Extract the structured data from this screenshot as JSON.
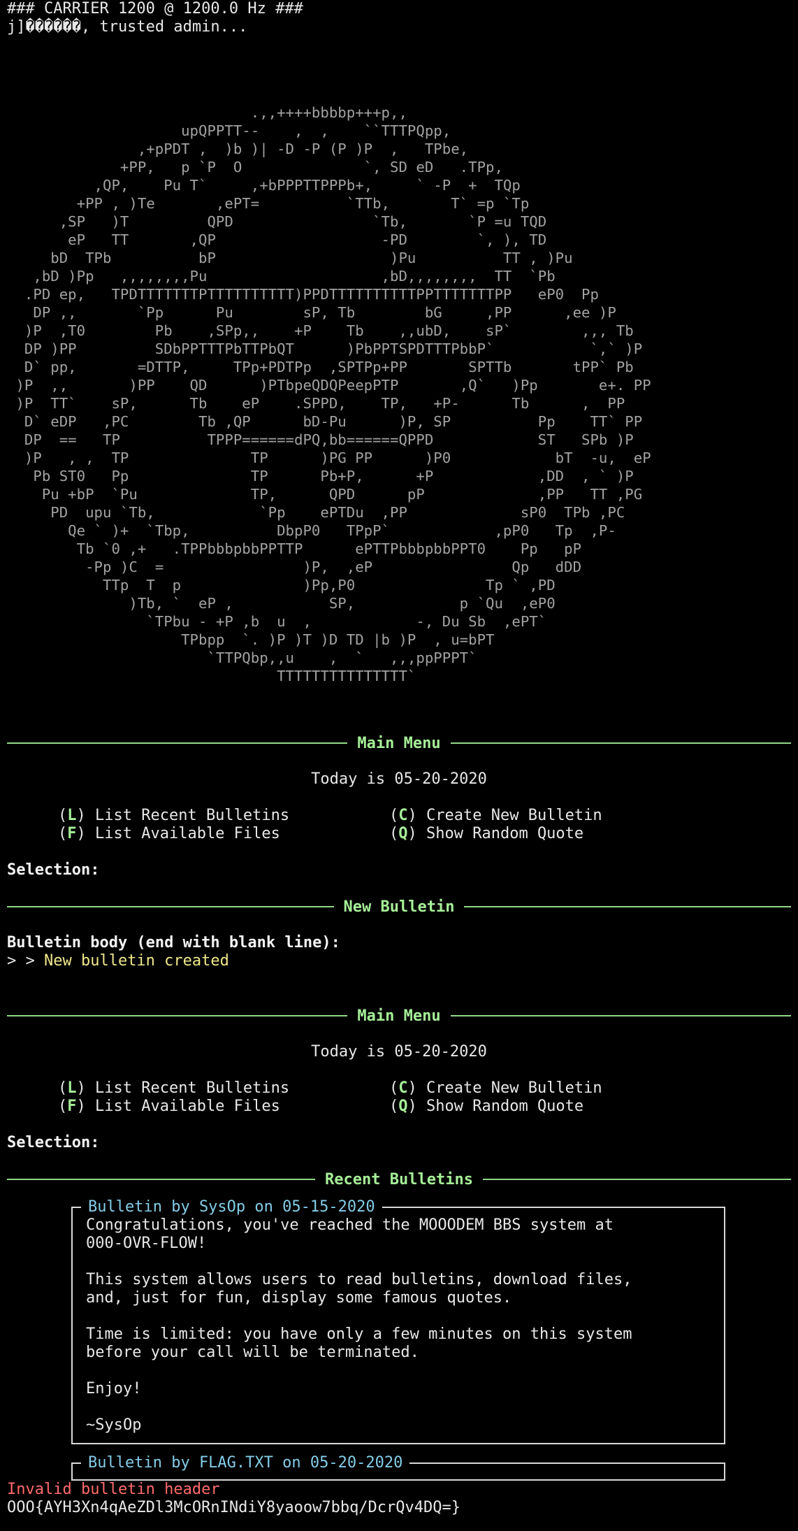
{
  "header": {
    "carrier": "### CARRIER 1200 @ 1200.0 Hz ###",
    "login": "j]������, trusted admin..."
  },
  "ascii_art": [
    "                            .,,++++bbbbp+++p,,",
    "                    upQPPTT--    ,  ,    ``TTTPQpp,",
    "               ,+pPDT ,  )b )| -D -P (P )P  ,   TPbe,",
    "             +PP,   p `P  O              `, SD eD   .TPp,",
    "          ,QP,    Pu T`     ,+bPPPTTPPPb+,     ` -P  +  TQp",
    "        +PP , )Te       ,ePT=          `TTb,       T` =p `Tp",
    "      ,SP   )T         QPD                `Tb,       `P =u TQD",
    "       eP   TT       ,QP                   -PD        `, ), TD",
    "     bD  TPb          bP                    )Pu          TT , )Pu",
    "   ,bD )Pp   ,,,,,,,,Pu                    ,bD,,,,,,,,  TT  `Pb",
    "  .PD ep,   TPDTTTTTTTPTTTTTTTTTT)PPDTTTTTTTTTTPPTTTTTTTPP   eP0  Pp",
    "   DP ,,       `Pp      Pu        sP, Tb        bG     ,PP      ,ee )P",
    "  )P  ,T0        Pb    ,SPp,,    +P    Tb    ,,ubD,    sP`        ,,, Tb",
    "  DP )PP         SDbPPTTTPbTTPbQT      )PbPPTSPDTTTPbbP`           `,` )P",
    "  D` pp,       =DTTP,     TPp+PDTPp  ,SPTPp+PP       SPTTb       tPP` Pb",
    " )P  ,,       )PP    QD      )PTbpeQDQPeepPTP       ,Q`   )Pp       e+. PP",
    " )P  TT`    sP,      Tb    eP    .SPPD,    TP,   +P-      Tb      ,  PP",
    "  D` eDP   ,PC        Tb ,QP      bD-Pu      )P, SP          Pp    TT` PP",
    "  DP  ==   TP          TPPP======dPQ,bb======QPPD            ST   SPb )P",
    "  )P   , ,  TP              TP      )PG PP      )P0            bT  -u,  eP",
    "   Pb ST0   Pp              TP      Pb+P,      +P            ,DD  , ` )P",
    "    Pu +bP  `Pu             TP,      QPD      pP             ,PP   TT ,PG",
    "     PD  upu `Tb,            `Pp    ePTDu  ,PP             sP0  TPb ,PC",
    "       Qe ` )+  `Tbp,          DbpP0   TPpP`            ,pP0   Tp  ,P-",
    "        Tb `0 ,+   .TPPbbbpbbPPTTP      ePTTPbbbpbbPPT0    Pp   pP",
    "         -Pp )C  =                )P,  ,eP                Qp   dDD",
    "           TTp  T  p              )Pp,P0               Tp ` ,PD",
    "              )Tb, `  eP ,           SP,            p `Qu  ,eP0",
    "                `TPbu - +P ,b  u  ,            -, Du Sb  ,ePT`",
    "                    TPbpp  `. )P )T )D TD |b )P  , u=bPT",
    "                       `TTPQbp,,u    ,  `   ,,,ppPPPT`",
    "                               TTTTTTTTTTTTTTT`"
  ],
  "menu1": {
    "title": "Main Menu",
    "date": "Today is 05-20-2020",
    "items": [
      {
        "key": "L",
        "label": "List Recent Bulletins"
      },
      {
        "key": "C",
        "label": "Create New Bulletin"
      },
      {
        "key": "F",
        "label": "List Available Files"
      },
      {
        "key": "Q",
        "label": "Show Random Quote"
      }
    ],
    "prompt": "Selection:"
  },
  "new_bulletin": {
    "title": "New Bulletin",
    "prompt": "Bulletin body (end with blank line):",
    "input_marks": "> > ",
    "result": "New bulletin created"
  },
  "menu2": {
    "title": "Main Menu",
    "date": "Today is 05-20-2020",
    "items": [
      {
        "key": "L",
        "label": "List Recent Bulletins"
      },
      {
        "key": "C",
        "label": "Create New Bulletin"
      },
      {
        "key": "F",
        "label": "List Available Files"
      },
      {
        "key": "Q",
        "label": "Show Random Quote"
      }
    ],
    "prompt": "Selection:"
  },
  "recent": {
    "title": "Recent Bulletins",
    "bulletins": [
      {
        "header": "Bulletin by SysOp on 05-15-2020",
        "lines": [
          "Congratulations, you've reached the MOOODEM BBS system at",
          "000-OVR-FLOW!",
          "",
          "This system allows users to read bulletins, download files,",
          "and, just for fun, display some famous quotes.",
          "",
          "Time is limited: you have only a few minutes on this system",
          "before your call will be terminated.",
          "",
          "Enjoy!",
          "",
          "~SysOp"
        ]
      },
      {
        "header": "Bulletin by FLAG.TXT on 05-20-2020",
        "lines": []
      }
    ],
    "error": "Invalid bulletin header",
    "flag": "OOO{AYH3Xn4qAeZDl3McORnINdiY8yaoow7bbq/DcrQv4DQ=}"
  },
  "colors": {
    "background": "#000000",
    "text": "#e8e8e8",
    "accent_green": "#a6ee98",
    "ascii_gray": "#a2a2a2",
    "yellow": "#f0e88c",
    "red": "#ff6b6b",
    "cyan": "#84cde8"
  }
}
